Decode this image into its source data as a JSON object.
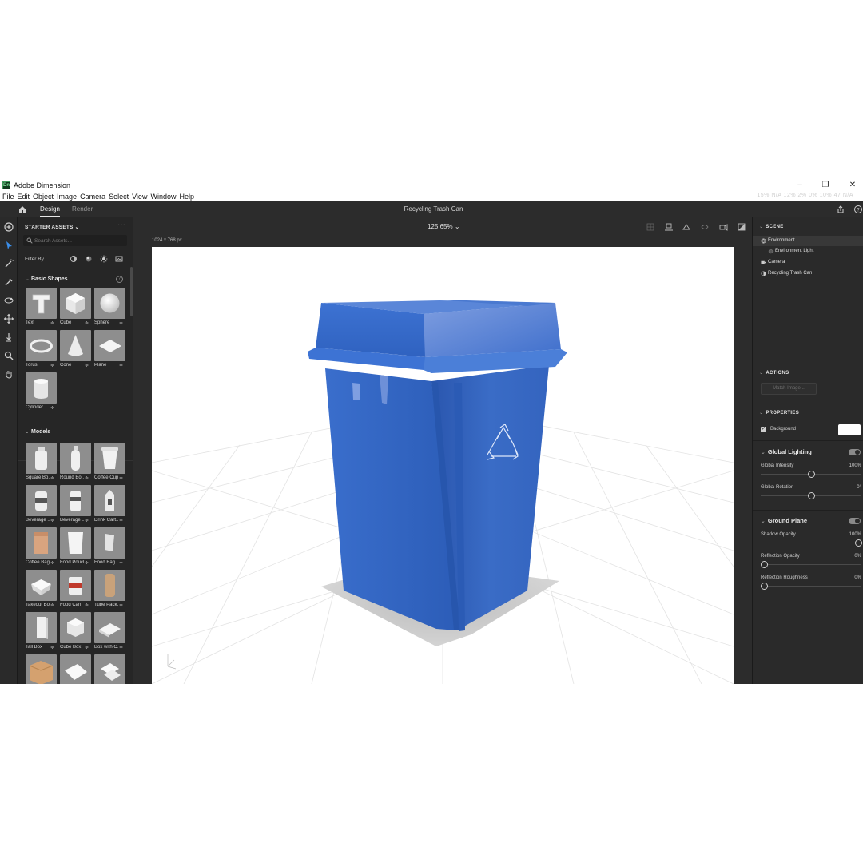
{
  "window": {
    "app_title": "Adobe Dimension",
    "logo_text": "Dn",
    "minimize": "–",
    "maximize": "❐",
    "close": "✕",
    "system_status": "15%  N/A  12%  2%  0%  10%  47  N/A"
  },
  "menu": [
    "File",
    "Edit",
    "Object",
    "Image",
    "Camera",
    "Select",
    "View",
    "Window",
    "Help"
  ],
  "topbar": {
    "tabs": [
      "Design",
      "Render"
    ],
    "active_tab": "Design",
    "document_title": "Recycling Trash Can"
  },
  "assets_panel": {
    "header": "STARTER ASSETS",
    "search_placeholder": "Search Assets...",
    "filter_label": "Filter By",
    "basic_shapes_title": "Basic Shapes",
    "basic_shapes": [
      "Text",
      "Cube",
      "Sphere",
      "Torus",
      "Cone",
      "Plane",
      "Cylinder"
    ],
    "models_title": "Models",
    "models": [
      "Square Bo...",
      "Round Bo...",
      "Coffee Cup",
      "Beverage ...",
      "Beverage ...",
      "Drink Cart...",
      "Coffee Bag",
      "Food Pouch",
      "Food Bag",
      "Takeout Box",
      "Food Can",
      "Tube Pack...",
      "Tall Box",
      "Cube Box",
      "Box with O..."
    ]
  },
  "viewport": {
    "zoom": "125.65%",
    "canvas_size": "1024 x 768 px"
  },
  "right_panel": {
    "scene_title": "SCENE",
    "scene_items": [
      "Environment",
      "Environment Light",
      "Camera",
      "Recycling Trash Can"
    ],
    "actions_title": "ACTIONS",
    "match_image": "Match Image...",
    "properties_title": "PROPERTIES",
    "background_label": "Background",
    "background_color": "#ffffff",
    "global_lighting": {
      "title": "Global Lighting",
      "enabled": true,
      "intensity_label": "Global Intensity",
      "intensity_value": "100%",
      "intensity_level": 0.5,
      "rotation_label": "Global Rotation",
      "rotation_value": "0°",
      "rotation_level": 0.5
    },
    "ground_plane": {
      "title": "Ground Plane",
      "enabled": true,
      "shadow_opacity_label": "Shadow Opacity",
      "shadow_opacity_value": "100%",
      "shadow_opacity_level": 1.0,
      "reflection_opacity_label": "Reflection Opacity",
      "reflection_opacity_value": "0%",
      "reflection_opacity_level": 0.0,
      "reflection_roughness_label": "Reflection Roughness",
      "reflection_roughness_value": "0%",
      "reflection_roughness_level": 0.0
    }
  },
  "colors": {
    "bin_blue": "#2f63c0",
    "accent_selection": "#383838"
  }
}
